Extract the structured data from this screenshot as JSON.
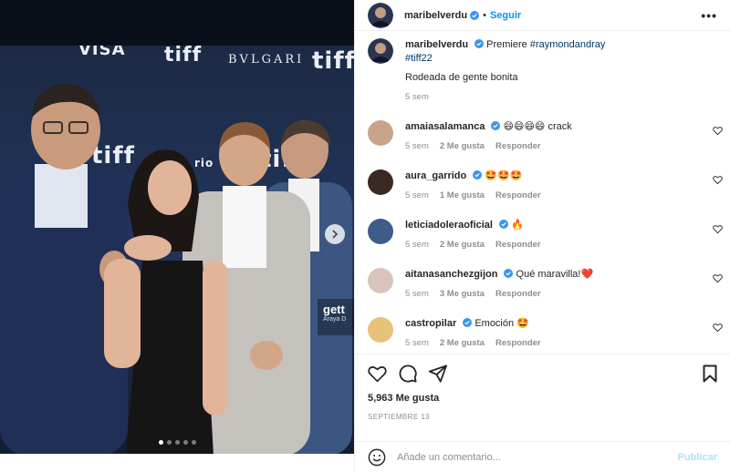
{
  "post": {
    "author": "maribelverdu",
    "follow_label": "Seguir",
    "separator": "•",
    "more_icon": "more-horizontal-icon",
    "caption": {
      "text_before": "Premiere",
      "tag1": "#raymondandray",
      "tag2": "#tiff22",
      "line2": "Rodeada de gente bonita",
      "age": "5 sem"
    },
    "likes": "5,963 Me gusta",
    "date": "SEPTIEMBRE 13",
    "add_comment_placeholder": "Añade un comentario...",
    "publish_label": "Publicar"
  },
  "media": {
    "backdrop": {
      "t1": "tiff",
      "t2": "tiff",
      "t3": "tiff",
      "t4": "tiff",
      "sponsor": "BVLGARI",
      "visa": "VISA",
      "fragment": "rio"
    },
    "watermark": {
      "main": "gett",
      "sub": "Araya D"
    },
    "slide_count": 5,
    "active_slide": 1
  },
  "comments": [
    {
      "user": "amaiasalamanca",
      "text": "😄😄😄😄 crack",
      "age": "5 sem",
      "likes": "2 Me gusta",
      "reply": "Responder",
      "avatar_color": "#caa48a"
    },
    {
      "user": "aura_garrido",
      "text": "🤩🤩🤩",
      "age": "5 sem",
      "likes": "1 Me gusta",
      "reply": "Responder",
      "avatar_color": "#3a2a22"
    },
    {
      "user": "leticiadoleraoficial",
      "text": "🔥",
      "age": "5 sem",
      "likes": "2 Me gusta",
      "reply": "Responder",
      "avatar_color": "#3e5b8a"
    },
    {
      "user": "aitanasanchezgijon",
      "text": "Qué maravilla!❤️",
      "age": "5 sem",
      "likes": "3 Me gusta",
      "reply": "Responder",
      "avatar_color": "#d8c4bc"
    },
    {
      "user": "castropilar",
      "text": "Emoción 🤩",
      "age": "5 sem",
      "likes": "2 Me gusta",
      "reply": "Responder",
      "avatar_color": "#e7c27a"
    }
  ],
  "colors": {
    "link": "#0095f6",
    "verified": "#3897f0",
    "hashtag": "#00376b",
    "muted": "#8e8e8e"
  }
}
